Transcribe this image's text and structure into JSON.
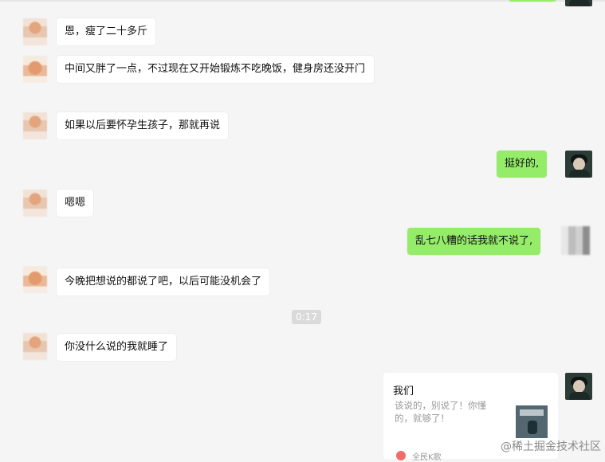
{
  "messages": [
    {
      "side": "left",
      "text": "恩，瘦了二十多斤"
    },
    {
      "side": "left",
      "text": "中间又胖了一点，不过现在又开始锻炼不吃晚饭，健身房还没开门"
    },
    {
      "side": "left",
      "text": "如果以后要怀孕生孩子，那就再说"
    },
    {
      "side": "right",
      "text": "挺好的,"
    },
    {
      "side": "left",
      "text": "嗯嗯"
    },
    {
      "side": "right",
      "text": "乱七八糟的话我就不说了,"
    },
    {
      "side": "left",
      "text": "今晚把想说的都说了吧，以后可能没机会了"
    },
    {
      "timestamp": "0:17"
    },
    {
      "side": "left",
      "text": "你没什么说的我就睡了"
    }
  ],
  "music_card": {
    "title": "我们",
    "description": "该说的，别说了！你懂的，就够了！",
    "source": "全民K歌"
  },
  "watermark": "@稀土掘金技术社区",
  "colors": {
    "background": "#f5f5f5",
    "incoming_bubble": "#ffffff",
    "outgoing_bubble": "#95ec69",
    "timestamp_bg": "#dadada"
  }
}
